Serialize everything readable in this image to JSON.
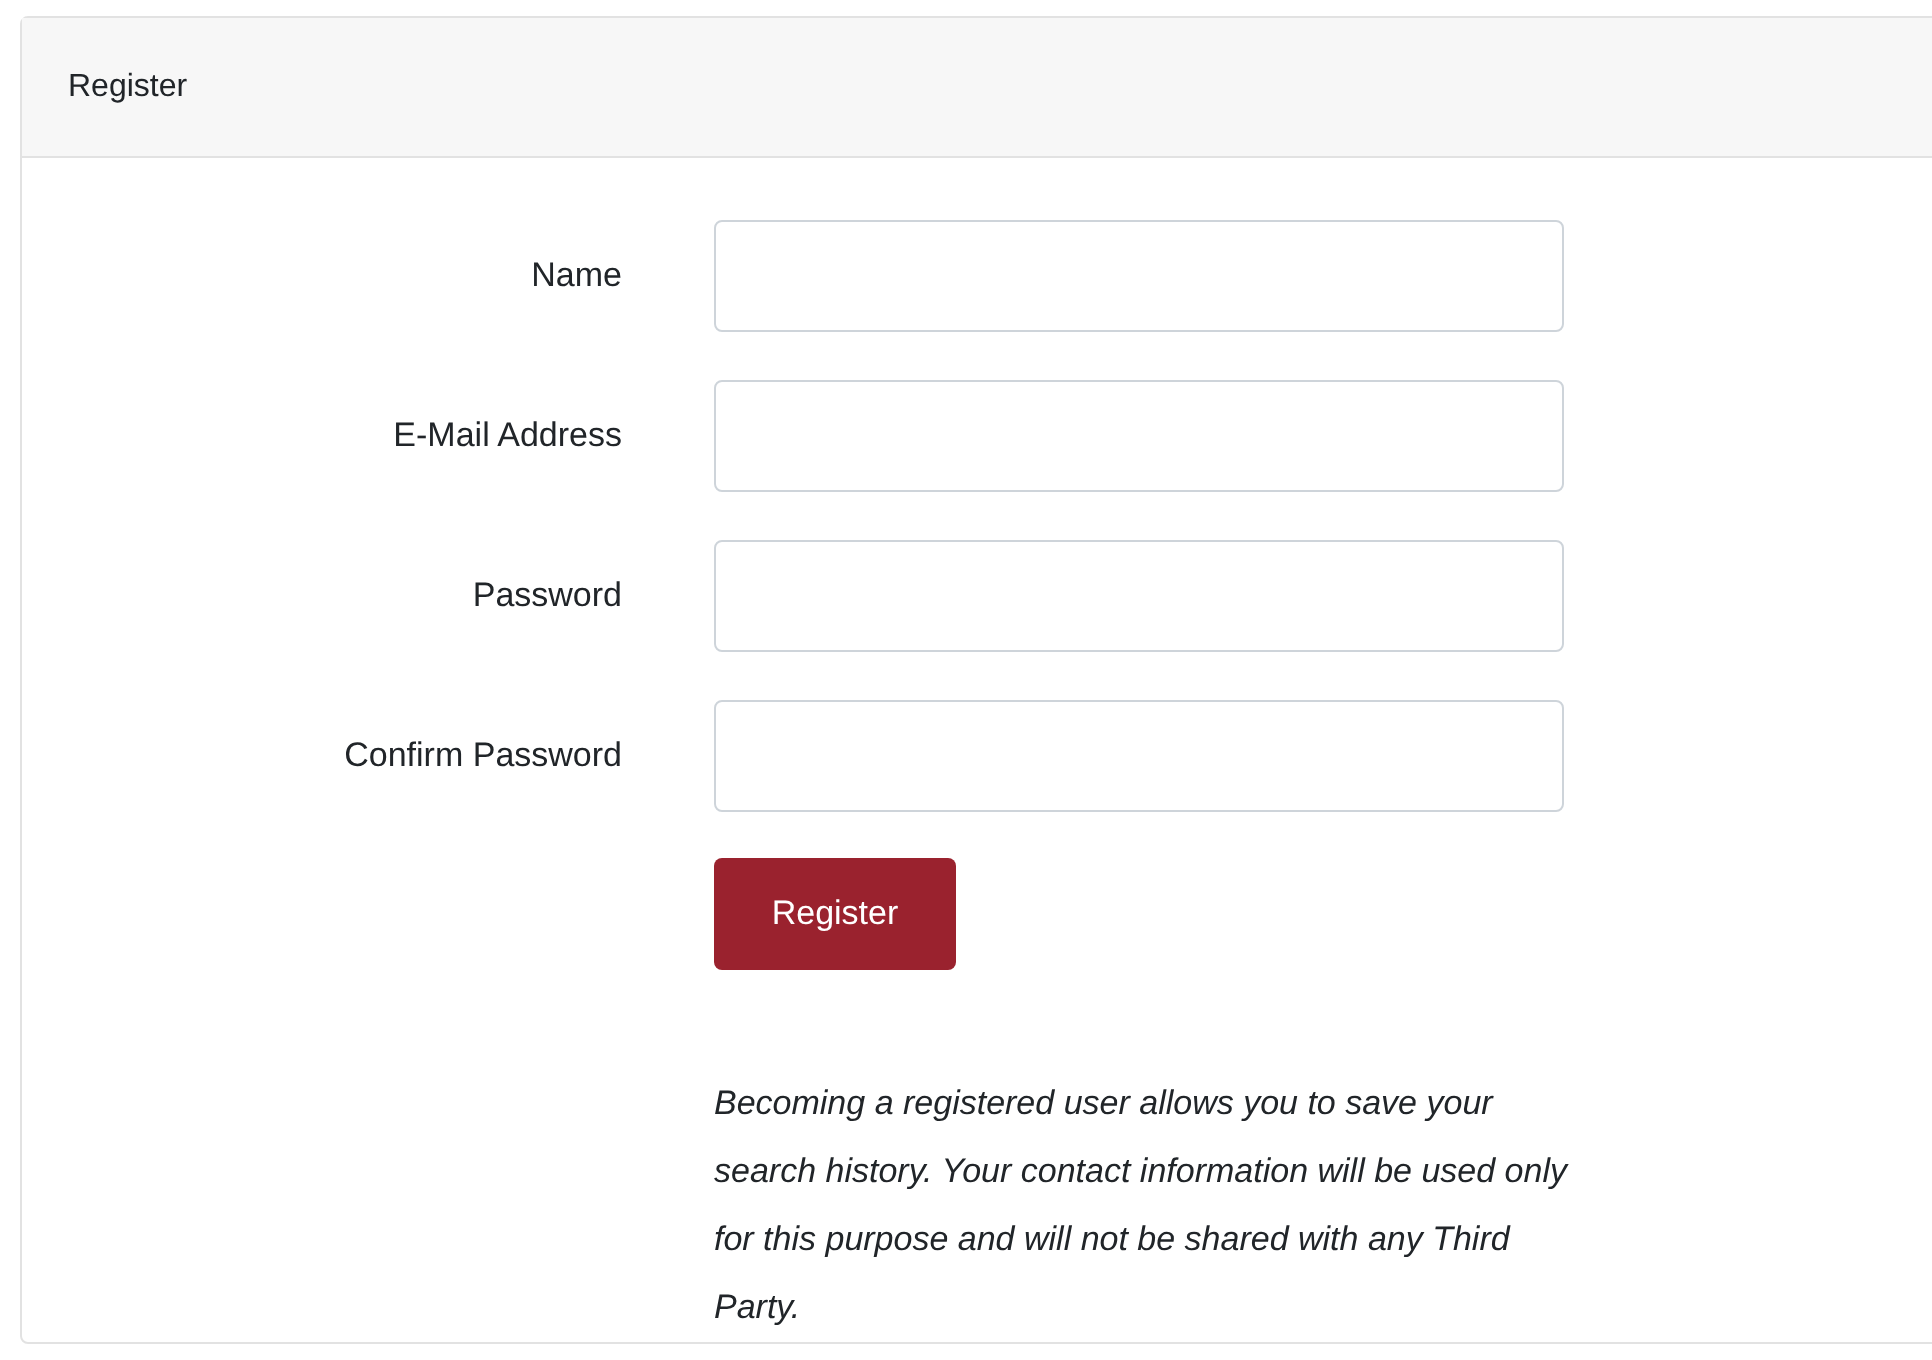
{
  "card": {
    "title": "Register"
  },
  "fields": [
    {
      "label": "Name"
    },
    {
      "label": "E-Mail Address"
    },
    {
      "label": "Password"
    },
    {
      "label": "Confirm Password"
    }
  ],
  "button": "Register",
  "note": "Becoming a registered user allows you to save your search history. Your contact information will be used only for this purpose and will not be shared with any Third Party."
}
